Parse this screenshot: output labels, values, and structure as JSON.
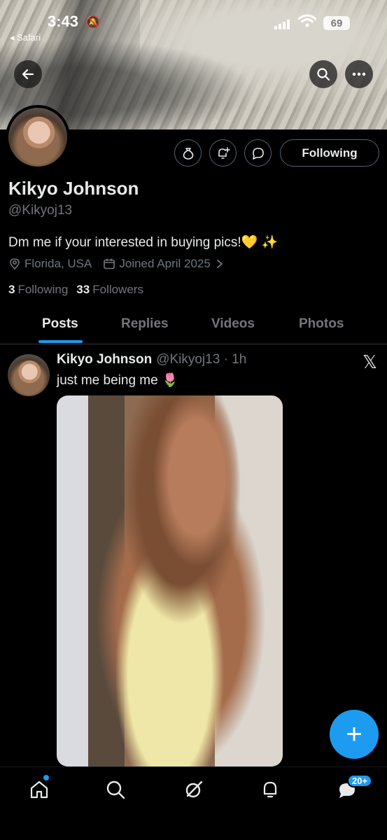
{
  "status_bar": {
    "time": "3:43",
    "back_app": "◂ Safari",
    "battery": "69"
  },
  "profile": {
    "display_name": "Kikyo Johnson",
    "handle": "@Kikyoj13",
    "bio": "Dm me if your interested in buying pics!💛 ✨",
    "location": "Florida, USA",
    "joined": "Joined April 2025",
    "following_count": "3",
    "following_label": "Following",
    "followers_count": "33",
    "followers_label": "Followers",
    "follow_button": "Following"
  },
  "tabs": [
    {
      "label": "Posts",
      "active": true
    },
    {
      "label": "Replies",
      "active": false
    },
    {
      "label": "Videos",
      "active": false
    },
    {
      "label": "Photos",
      "active": false
    }
  ],
  "post": {
    "author": "Kikyo Johnson",
    "handle_time": "@Kikyoj13 · 1h",
    "text": "just me being me 🌷",
    "x_logo": "𝕏"
  },
  "fab": {
    "label": "+"
  },
  "nav": {
    "messages_badge": "20+"
  },
  "colors": {
    "accent": "#1d9bf0",
    "background": "#000000",
    "muted": "#71767b"
  }
}
